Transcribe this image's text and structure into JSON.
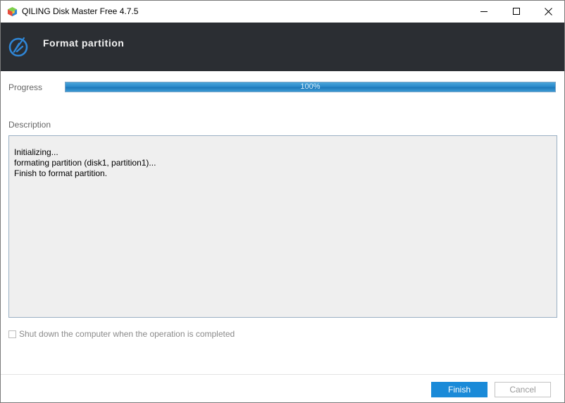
{
  "window": {
    "title": "QILING Disk Master Free 4.7.5",
    "controls": [
      "minimize",
      "maximize",
      "close"
    ]
  },
  "header": {
    "title": "Format partition",
    "icon": "format-partition-icon"
  },
  "progress": {
    "label": "Progress",
    "percent": 100,
    "text": "100%"
  },
  "description": {
    "label": "Description",
    "lines": [
      "Initializing...",
      "formating partition (disk1, partition1)...",
      "Finish to format partition."
    ]
  },
  "shutdown_option": {
    "label": "Shut down the computer when the operation is completed",
    "checked": false,
    "enabled": false
  },
  "buttons": {
    "finish": "Finish",
    "cancel": "Cancel"
  },
  "colors": {
    "header_bg": "#2b2e33",
    "accent": "#1a8ad8",
    "progress_fill": "#2a8acb",
    "description_bg": "#efefef"
  }
}
